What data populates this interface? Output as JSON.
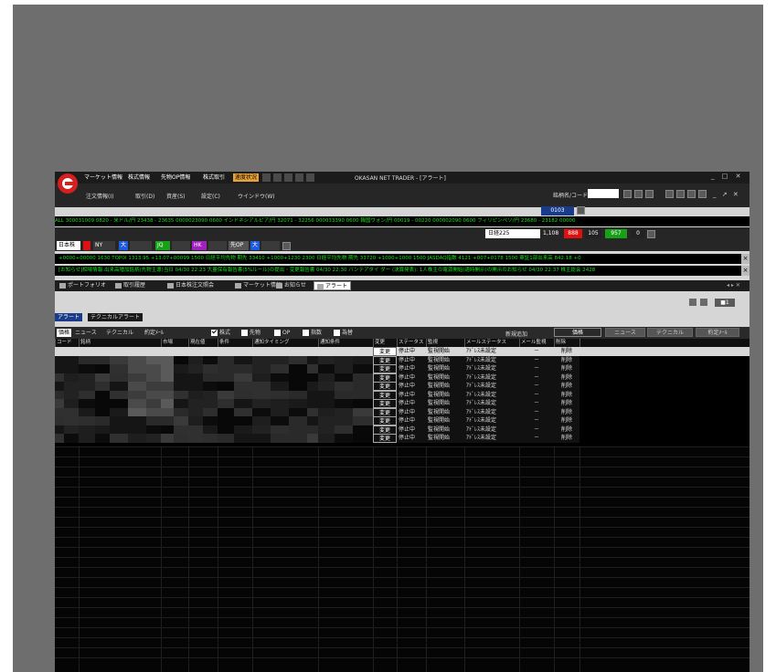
{
  "title_bar": {
    "menus": [
      "マーケット情報",
      "株式情報",
      "先物OP情報",
      "株式取引",
      "速度状況"
    ],
    "app_title": "OKASAN NET TRADER - [アラート]",
    "window_controls": "_ □ ✕"
  },
  "menu_bar": {
    "items": [
      "注文情報(I)",
      "取引(D)",
      "資産(S)",
      "設定(C)",
      "ウインドウ(W)"
    ],
    "code_label": "銘柄名/コード:",
    "code_value": "",
    "counter": "0103",
    "right_controls": "_ ↗ ✕"
  },
  "ticker_line_1": "ALL 300031009 0820 - 米ドル/円 23438 - 23635 0000023090 0600 インドネシアルピア/円 32071 - 32256 000033390 0600 韓国ウォン/円 00019 - 00220 000002090 0600 フィリピンペソ/円 23680 - 23182 00000",
  "nikkei": {
    "label": "日経225",
    "value": "1,108",
    "cells": [
      "888",
      "105",
      "957",
      "0"
    ]
  },
  "markets": [
    "日本株",
    "NY",
    "大",
    "JQ",
    "HK",
    "先OP",
    "大"
  ],
  "ticker_line_2": "+0000+00000 1630 TOPIX 1313.95 +13.07+00099 1500 日経平均先物 期先 33410 +1000+1230 2300 日経平均先物 期先 33720 +1000+1000 1500 JASDAQ指数 4121 +007+0178 1500 東証1部出来高 842.18 +0",
  "ticker_line_3": "[お知らせ]相場情報:出来高増加銘柄(先物主導)当日 04/30 22:23 大量保有報告書(5%ルール)の提出・変更報告書 04/30 22:30 バンテアタイ ダー (決算発表); 1人株主の電源開始(適時開示)の開示のお知らせ 04/30 22:37 株主総会 2428",
  "workspace_tabs": [
    "ポートフォリオ",
    "取引履歴",
    "日本株注文照会",
    "マーケット情報",
    "お知らせ",
    "アラート"
  ],
  "workspace_tab_right": "◂ ▸ ✕",
  "view_dropdown": "■1",
  "alert_tabs": [
    "アラート",
    "テクニカルアラート"
  ],
  "panel_tabs": [
    "価格",
    "ニュース",
    "テクニカル",
    "約定ﾒｰﾙ"
  ],
  "filters": [
    {
      "label": "株式",
      "checked": true
    },
    {
      "label": "先物",
      "checked": false
    },
    {
      "label": "OP",
      "checked": false
    },
    {
      "label": "指数",
      "checked": false
    },
    {
      "label": "為替",
      "checked": false
    }
  ],
  "new_alert_label": "新規追加",
  "new_alert_buttons": [
    "価格",
    "ニュース",
    "テクニカル",
    "約定ﾒｰﾙ"
  ],
  "columns": [
    "コード",
    "銘柄",
    "市場",
    "現在値",
    "条件",
    "通知タイミング",
    "通知条件",
    "変更",
    "ステータス",
    "監視",
    "メールステータス",
    "メール監視",
    "削除"
  ],
  "rows": [
    {
      "change": "変更",
      "status": "停止中",
      "monitor": "監視開始",
      "mail_status": "ｱﾄﾞﾚｽ未設定",
      "mail_monitor": "－",
      "delete": "削除"
    },
    {
      "change": "変更",
      "status": "停止中",
      "monitor": "監視開始",
      "mail_status": "ｱﾄﾞﾚｽ未設定",
      "mail_monitor": "－",
      "delete": "削除"
    },
    {
      "change": "変更",
      "status": "停止中",
      "monitor": "監視開始",
      "mail_status": "ｱﾄﾞﾚｽ未設定",
      "mail_monitor": "－",
      "delete": "削除"
    },
    {
      "change": "変更",
      "status": "停止中",
      "monitor": "監視開始",
      "mail_status": "ｱﾄﾞﾚｽ未設定",
      "mail_monitor": "－",
      "delete": "削除"
    },
    {
      "change": "変更",
      "status": "停止中",
      "monitor": "監視開始",
      "mail_status": "ｱﾄﾞﾚｽ未設定",
      "mail_monitor": "－",
      "delete": "削除"
    },
    {
      "change": "変更",
      "status": "停止中",
      "monitor": "監視開始",
      "mail_status": "ｱﾄﾞﾚｽ未設定",
      "mail_monitor": "－",
      "delete": "削除"
    },
    {
      "change": "変更",
      "status": "停止中",
      "monitor": "監視開始",
      "mail_status": "ｱﾄﾞﾚｽ未設定",
      "mail_monitor": "－",
      "delete": "削除"
    },
    {
      "change": "変更",
      "status": "停止中",
      "monitor": "監視開始",
      "mail_status": "ｱﾄﾞﾚｽ未設定",
      "mail_monitor": "－",
      "delete": "削除"
    },
    {
      "change": "変更",
      "status": "停止中",
      "monitor": "監視開始",
      "mail_status": "ｱﾄﾞﾚｽ未設定",
      "mail_monitor": "－",
      "delete": "削除"
    },
    {
      "change": "変更",
      "status": "停止中",
      "monitor": "監視開始",
      "mail_status": "ｱﾄﾞﾚｽ未設定",
      "mail_monitor": "－",
      "delete": "削除"
    },
    {
      "change": "変更",
      "status": "停止中",
      "monitor": "監視開始",
      "mail_status": "ｱﾄﾞﾚｽ未設定",
      "mail_monitor": "－",
      "delete": "削除"
    }
  ],
  "colors": {
    "desktop": "#6e6e6e",
    "ticker_text": "#19e019",
    "accent_orange": "#e8a23a",
    "alert_tab_active": "#1a3a8a",
    "selected_row": "#d8d8d8"
  }
}
